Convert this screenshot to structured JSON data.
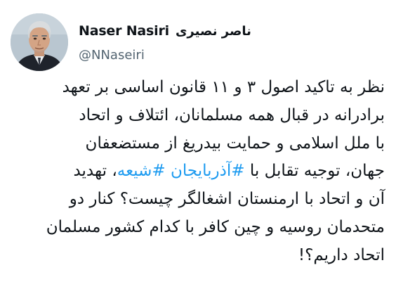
{
  "author": {
    "display_name": "Naser Nasiri",
    "display_name_fa": "ناصر نصیری",
    "handle": "@NNaseiri",
    "avatar_icon": "profile-photo"
  },
  "tweet": {
    "lines": [
      "نظر به تاکید اصول ۳ و ۱۱ قانون اساسی بر تعهد",
      "برادرانه در قبال همه مسلمانان، ائتلاف و اتحاد",
      "با ملل اسلامی و حمایت بیدریغ از مستضعفان",
      {
        "before": "جهان، توجیه تقابل با ",
        "hashtag_1": "#آذربایجان",
        "space": " ",
        "hashtag_2": "#شیعه",
        "after": "، تهدید"
      },
      "آن و اتحاد با ارمنستان اشغالگر چیست؟ کنار دو",
      "متحدمان روسیه و چین کافر با کدام کشور مسلمان",
      "اتحاد داریم؟!"
    ]
  },
  "colors": {
    "text": "#0f1419",
    "secondary": "#536471",
    "link": "#1d9bf0",
    "background": "#ffffff"
  }
}
